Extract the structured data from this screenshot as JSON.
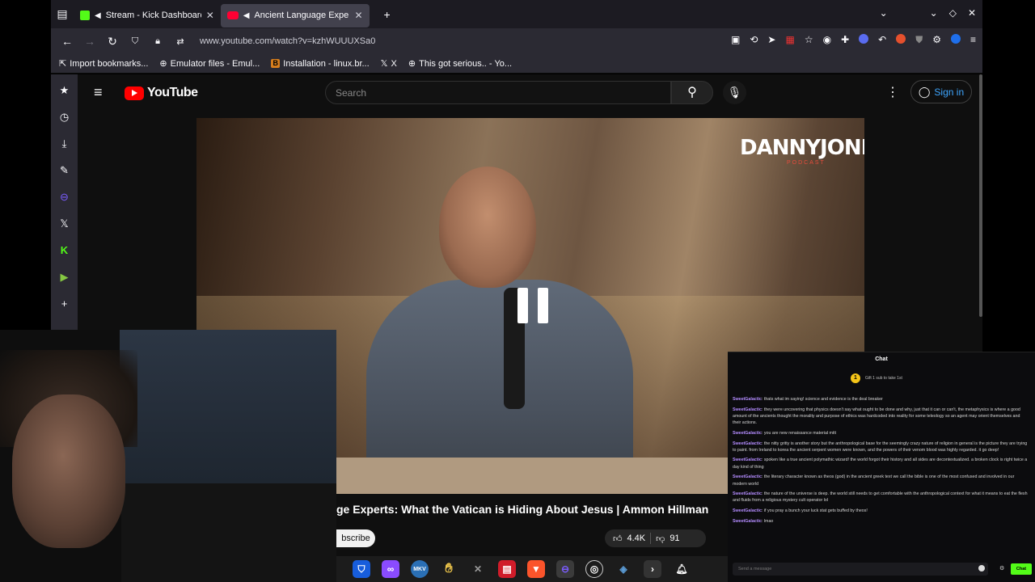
{
  "browser": {
    "tabs": [
      {
        "label": "Stream - Kick Dashboard",
        "icon": "kick-icon",
        "active": false
      },
      {
        "label": "Ancient Language Expe",
        "icon": "youtube-icon",
        "active": true
      }
    ],
    "url": "www.youtube.com/watch?v=kzhWUUUXSa0",
    "bookmarks": [
      {
        "label": "Import bookmarks...",
        "icon": "import-icon"
      },
      {
        "label": "Emulator files - Emul...",
        "icon": "globe-icon"
      },
      {
        "label": "Installation - linux.br...",
        "icon": "b-icon"
      },
      {
        "label": "X",
        "icon": "x-icon"
      },
      {
        "label": "This got serious.. - Yo...",
        "icon": "globe-icon"
      }
    ]
  },
  "youtube": {
    "logo_text": "YouTube",
    "search_placeholder": "Search",
    "signin_label": "Sign in",
    "channel_brand": "DANNYJONES",
    "channel_brand_sub": "PODCAST",
    "video_title": "ge Experts: What the Vatican is Hiding About Jesus | Ammon Hillman",
    "subscribe_label": "bscribe",
    "likes": "4.4K",
    "dislikes": "91"
  },
  "chat": {
    "title": "Chat",
    "gift_text": "Gift 1 sub to take 1st",
    "gift_badge": "1",
    "messages": [
      {
        "user": "SweetGalactic",
        "text": "thats what im saying! science and evidence is the deal breaker"
      },
      {
        "user": "SweetGalactic",
        "text": "they were uncovering that physics doesn't say what ought to be done and why, just that it can or can't, the metaphysics is where a good amount of the ancients thought the morality and purpose of ethics was hardcoded into reality for some teleology so an agent may orient themselves and their actions."
      },
      {
        "user": "SweetGalactic",
        "text": "you are new renaissance material mitt"
      },
      {
        "user": "SweetGalactic",
        "text": "the nitty gritty is another story but the anthropological base for the seemingly crazy nature of religion in general is the picture they are trying to paint. from Ireland to korea the ancient serpent women were known, and the powers of their venom blood was highly regarded. it go deep!"
      },
      {
        "user": "SweetGalactic",
        "text": "spoken like a true ancient polymathic wizard! the world forgot their history and all sides are decontextualized. a broken clock is right twice a day kind of thing"
      },
      {
        "user": "SweetGalactic",
        "text": "the literary character known as theos (god) in the ancient greek text we call the bible is one of the most confused and involved in our modern world"
      },
      {
        "user": "SweetGalactic",
        "text": "the nature of the universe is deep. the world still needs to get comfortable with the anthropological context for what it means to eat the flesh and fluids from a religious mystery cult operator lol"
      },
      {
        "user": "SweetGalactic",
        "text": "if you pray a bunch your luck stat gets buffed by theos!"
      },
      {
        "user": "SweetGalactic",
        "text": "lmao"
      }
    ],
    "input_placeholder": "Send a message",
    "send_label": "Chat"
  },
  "taskbar": {
    "items": [
      "bitwarden-icon",
      "proton-icon",
      "mkv-icon",
      "hand-icon",
      "tools-icon",
      "red-app-icon",
      "brave-icon",
      "kick-studio-icon",
      "obs-icon",
      "app-icon",
      "terminal-icon"
    ],
    "active_index": 7
  }
}
